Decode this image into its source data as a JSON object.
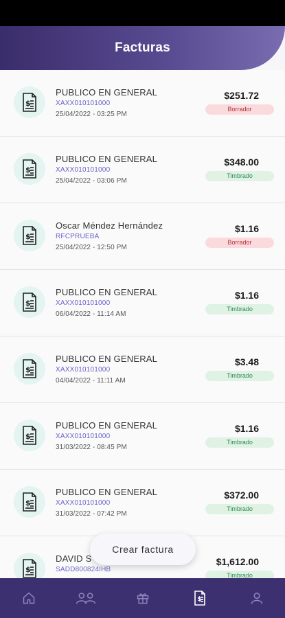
{
  "header": {
    "title": "Facturas"
  },
  "invoices": [
    {
      "name": "PUBLICO EN GENERAL",
      "rfc": "XAXX010101000",
      "date": "25/04/2022 - 03:25 PM",
      "amount": "$251.72",
      "status": "Borrador"
    },
    {
      "name": "PUBLICO EN GENERAL",
      "rfc": "XAXX010101000",
      "date": "25/04/2022 - 03:06 PM",
      "amount": "$348.00",
      "status": "Timbrado"
    },
    {
      "name": "Oscar Méndez Hernández",
      "rfc": "RFCPRUEBA",
      "date": "25/04/2022 - 12:50 PM",
      "amount": "$1.16",
      "status": "Borrador"
    },
    {
      "name": "PUBLICO EN GENERAL",
      "rfc": "XAXX010101000",
      "date": "06/04/2022 - 11:14 AM",
      "amount": "$1.16",
      "status": "Timbrado"
    },
    {
      "name": "PUBLICO EN GENERAL",
      "rfc": "XAXX010101000",
      "date": "04/04/2022 - 11:11 AM",
      "amount": "$3.48",
      "status": "Timbrado"
    },
    {
      "name": "PUBLICO EN GENERAL",
      "rfc": "XAXX010101000",
      "date": "31/03/2022 - 08:45 PM",
      "amount": "$1.16",
      "status": "Timbrado"
    },
    {
      "name": "PUBLICO EN GENERAL",
      "rfc": "XAXX010101000",
      "date": "31/03/2022 - 07:42 PM",
      "amount": "$372.00",
      "status": "Timbrado"
    },
    {
      "name": "DAVID S",
      "rfc": "SADD800824IHB",
      "date": "",
      "amount": "$1,612.00",
      "status": "Timbrado"
    }
  ],
  "fab": {
    "label": "Crear factura"
  },
  "bottom_nav": {
    "items": [
      {
        "icon": "home-icon",
        "active": false
      },
      {
        "icon": "users-icon",
        "active": false
      },
      {
        "icon": "gift-icon",
        "active": false
      },
      {
        "icon": "invoice-icon",
        "active": true
      },
      {
        "icon": "person-icon",
        "active": false
      }
    ]
  },
  "colors": {
    "header_start": "#3a2d6b",
    "header_end": "#7a6cb0",
    "nav_bg": "#3d3070",
    "rfc_text": "#6a63c9",
    "borrador_bg": "#fadadd",
    "timbrado_bg": "#dff2e4"
  }
}
